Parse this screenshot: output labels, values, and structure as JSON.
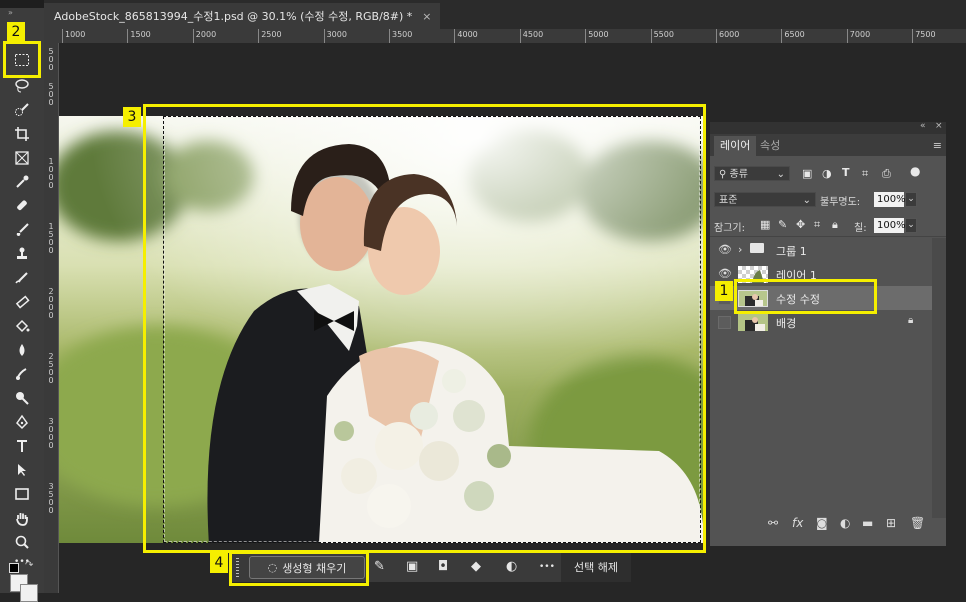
{
  "document_tab": {
    "title": "AdobeStock_865813994_수정1.psd @ 30.1% (수정 수정, RGB/8#) *",
    "close": "×"
  },
  "toolbar": {
    "collapse": "»",
    "more": "•••"
  },
  "rulers": {
    "top": [
      "1000",
      "1500",
      "2000",
      "2500",
      "3000",
      "3500",
      "4000",
      "4500",
      "5000",
      "5500",
      "6000",
      "6500",
      "7000",
      "7500"
    ],
    "left": [
      "5\n0\n0",
      "5\n0\n0",
      "1\n0\n0\n0",
      "1\n5\n0\n0",
      "2\n0\n0\n0",
      "2\n5\n0\n0",
      "3\n0\n0\n0",
      "3\n5\n0\n0"
    ]
  },
  "layers_panel": {
    "collapse": "«",
    "close": "×",
    "tabs": [
      "레이어",
      "속성"
    ],
    "menu": "≡",
    "filter_label": "종류",
    "blend_mode": "표준",
    "opacity_label": "불투명도:",
    "opacity_value": "100%",
    "lock_label": "잠그기:",
    "fill_label": "칠:",
    "fill_value": "100%",
    "layers": [
      {
        "name": "그룹 1",
        "visible": true,
        "type": "group"
      },
      {
        "name": "레이어 1",
        "visible": true,
        "type": "pixel"
      },
      {
        "name": "수정 수정",
        "visible": false,
        "type": "pixel",
        "selected": true
      },
      {
        "name": "배경",
        "visible": false,
        "type": "background",
        "locked": true
      }
    ]
  },
  "taskbar": {
    "generative_fill": "생성형 채우기",
    "more": "•••",
    "deselect": "선택 해제"
  },
  "callouts": [
    "1",
    "2",
    "3",
    "4"
  ],
  "colors": {
    "highlight": "#f5ef00",
    "panel_bg": "#535353",
    "toolbar_bg": "#3c3c3c"
  }
}
